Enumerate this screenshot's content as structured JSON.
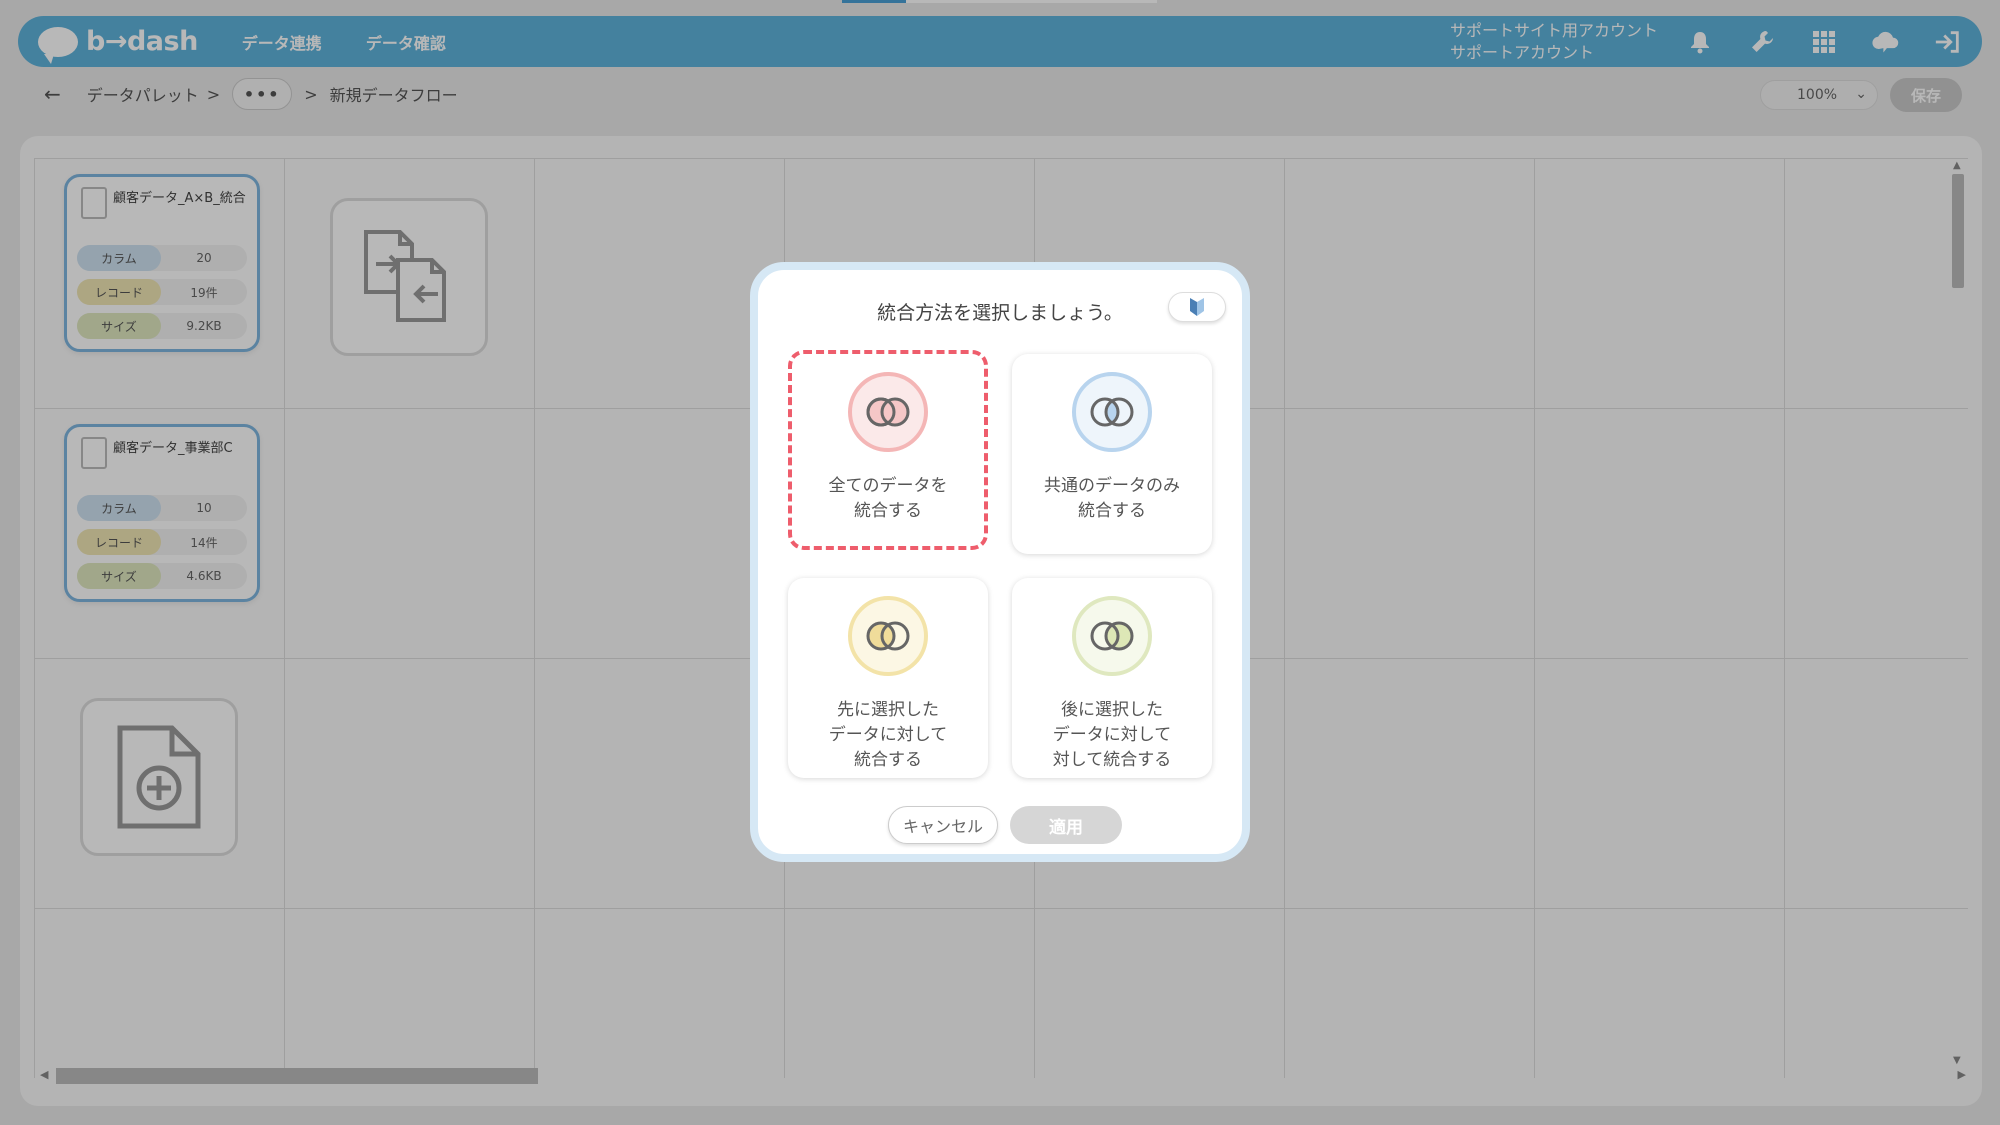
{
  "header": {
    "logo": "b→dash",
    "nav": [
      "データ連携",
      "データ確認"
    ],
    "account_line1": "サポートサイト用アカウント",
    "account_line2": "サポートアカウント",
    "icons": [
      "bell-icon",
      "wrench-icon",
      "grid-icon",
      "chat-cloud-icon",
      "logout-icon"
    ],
    "accent": "#5fb3dc"
  },
  "breadcrumb": {
    "back": "←",
    "items": [
      "データパレット",
      ">",
      "•••",
      ">",
      "新規データフロー"
    ],
    "zoom": "100%",
    "save": "保存"
  },
  "canvas": {
    "cards": [
      {
        "title": "顧客データ_A×B_統合",
        "stats": [
          {
            "label": "カラム",
            "value": "20"
          },
          {
            "label": "レコード",
            "value": "19件"
          },
          {
            "label": "サイズ",
            "value": "9.2KB"
          }
        ]
      },
      {
        "title": "顧客データ_事業部C",
        "stats": [
          {
            "label": "カラム",
            "value": "10"
          },
          {
            "label": "レコード",
            "value": "14件"
          },
          {
            "label": "サイズ",
            "value": "4.6KB"
          }
        ]
      }
    ]
  },
  "modal": {
    "title": "統合方法を選択しましょう。",
    "options": [
      {
        "label": "全てのデータを\n統合する",
        "icon": "venn-full-join-icon",
        "color": "#f4b6b6",
        "selected": true
      },
      {
        "label": "共通のデータのみ\n統合する",
        "icon": "venn-inner-join-icon",
        "color": "#b8d4ee",
        "selected": false
      },
      {
        "label": "先に選択した\nデータに対して\n統合する",
        "icon": "venn-left-join-icon",
        "color": "#f3e3a8",
        "selected": false
      },
      {
        "label": "後に選択した\nデータに対して\n対して統合する",
        "icon": "venn-right-join-icon",
        "color": "#dfe8bf",
        "selected": false
      }
    ],
    "cancel": "キャンセル",
    "apply": "適用",
    "selected_border": "#ee5d6c"
  }
}
